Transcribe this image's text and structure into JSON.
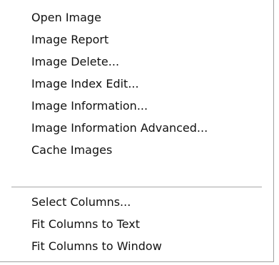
{
  "context_menu": {
    "groups": [
      {
        "items": [
          {
            "label": "Open Image"
          },
          {
            "label": "Image Report"
          },
          {
            "label": "Image Delete..."
          },
          {
            "label": "Image Index Edit..."
          },
          {
            "label": "Image Information..."
          },
          {
            "label": "Image Information Advanced..."
          },
          {
            "label": "Cache Images"
          }
        ]
      },
      {
        "items": [
          {
            "label": "Select Columns..."
          },
          {
            "label": "Fit Columns to Text"
          },
          {
            "label": "Fit Columns to Window"
          }
        ]
      }
    ]
  }
}
